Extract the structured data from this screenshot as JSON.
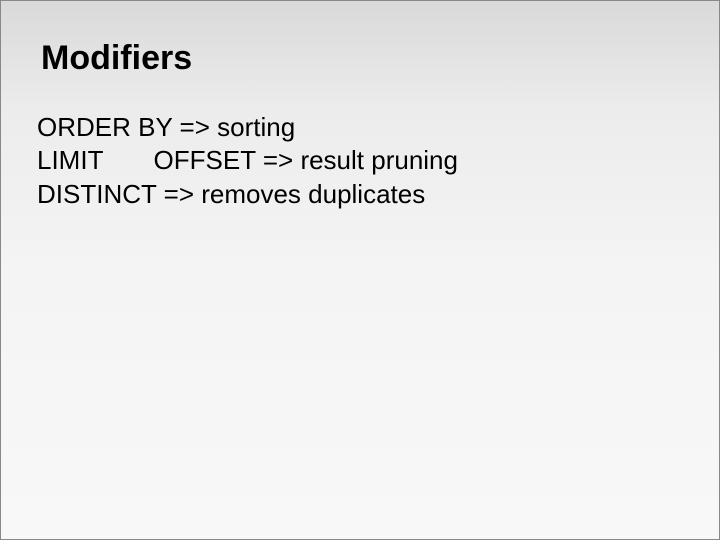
{
  "slide": {
    "title": "Modifiers",
    "lines": [
      "ORDER BY => sorting",
      "LIMIT       OFFSET => result pruning",
      "DISTINCT => removes duplicates"
    ]
  }
}
